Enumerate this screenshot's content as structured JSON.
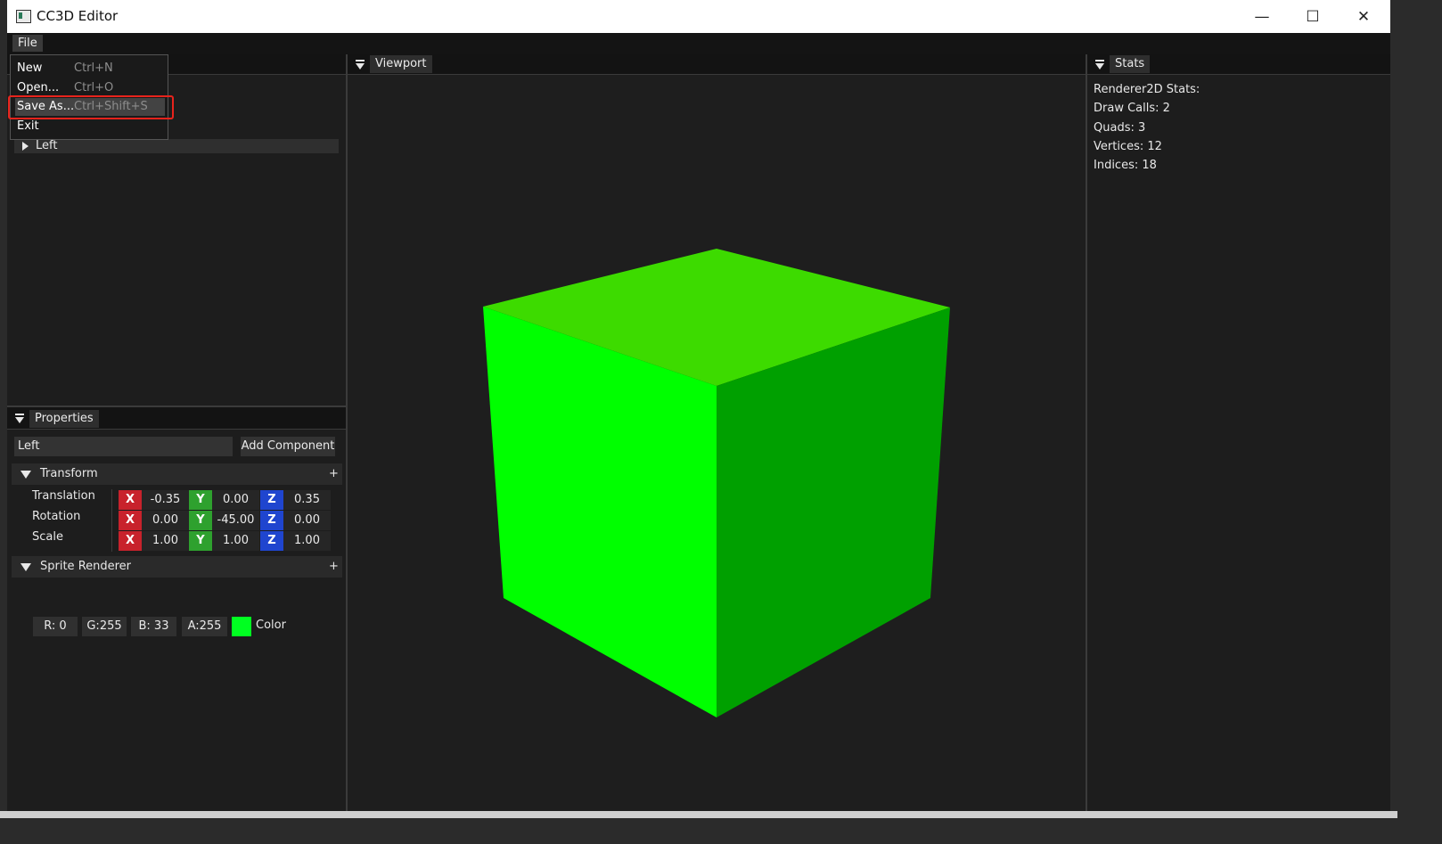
{
  "window": {
    "title": "CC3D Editor",
    "minimize_glyph": "—",
    "maximize_glyph": "☐",
    "close_glyph": "✕"
  },
  "menubar": {
    "file": "File"
  },
  "file_menu": {
    "items": [
      {
        "label": "New",
        "shortcut": "Ctrl+N"
      },
      {
        "label": "Open...",
        "shortcut": "Ctrl+O"
      },
      {
        "label": "Save As...",
        "shortcut": "Ctrl+Shift+S"
      },
      {
        "label": "Exit",
        "shortcut": ""
      }
    ]
  },
  "hierarchy": {
    "rows": [
      {
        "label": "Left"
      }
    ]
  },
  "viewport": {
    "tab_label": "Viewport",
    "cube": {
      "top_color": "#3ddb00",
      "left_color": "#00ff00",
      "right_color": "#00a000",
      "background": "#1e1e1e"
    }
  },
  "stats": {
    "tab_label": "Stats",
    "heading": "Renderer2D Stats:",
    "lines": [
      "Draw Calls: 2",
      "Quads: 3",
      "Vertices: 12",
      "Indices: 18"
    ]
  },
  "properties": {
    "tab_label": "Properties",
    "entity_name": "Left",
    "add_component_label": "Add Component",
    "transform": {
      "title": "Transform",
      "plus": "+",
      "rows": [
        {
          "label": "Translation",
          "x": "-0.35",
          "y": "0.00",
          "z": "0.35"
        },
        {
          "label": "Rotation",
          "x": "0.00",
          "y": "-45.00",
          "z": "0.00"
        },
        {
          "label": "Scale",
          "x": "1.00",
          "y": "1.00",
          "z": "1.00"
        }
      ],
      "axis_labels": {
        "x": "X",
        "y": "Y",
        "z": "Z"
      }
    },
    "sprite_renderer": {
      "title": "Sprite Renderer",
      "plus": "+",
      "channels": [
        "R: 0",
        "G:255",
        "B: 33",
        "A:255"
      ],
      "swatch_color": "#00ff21",
      "color_label": "Color"
    }
  },
  "colors": {
    "axis_x": "#c8222c",
    "axis_y": "#2ea12e",
    "axis_z": "#1f45cf",
    "highlight": "#e8231c"
  }
}
